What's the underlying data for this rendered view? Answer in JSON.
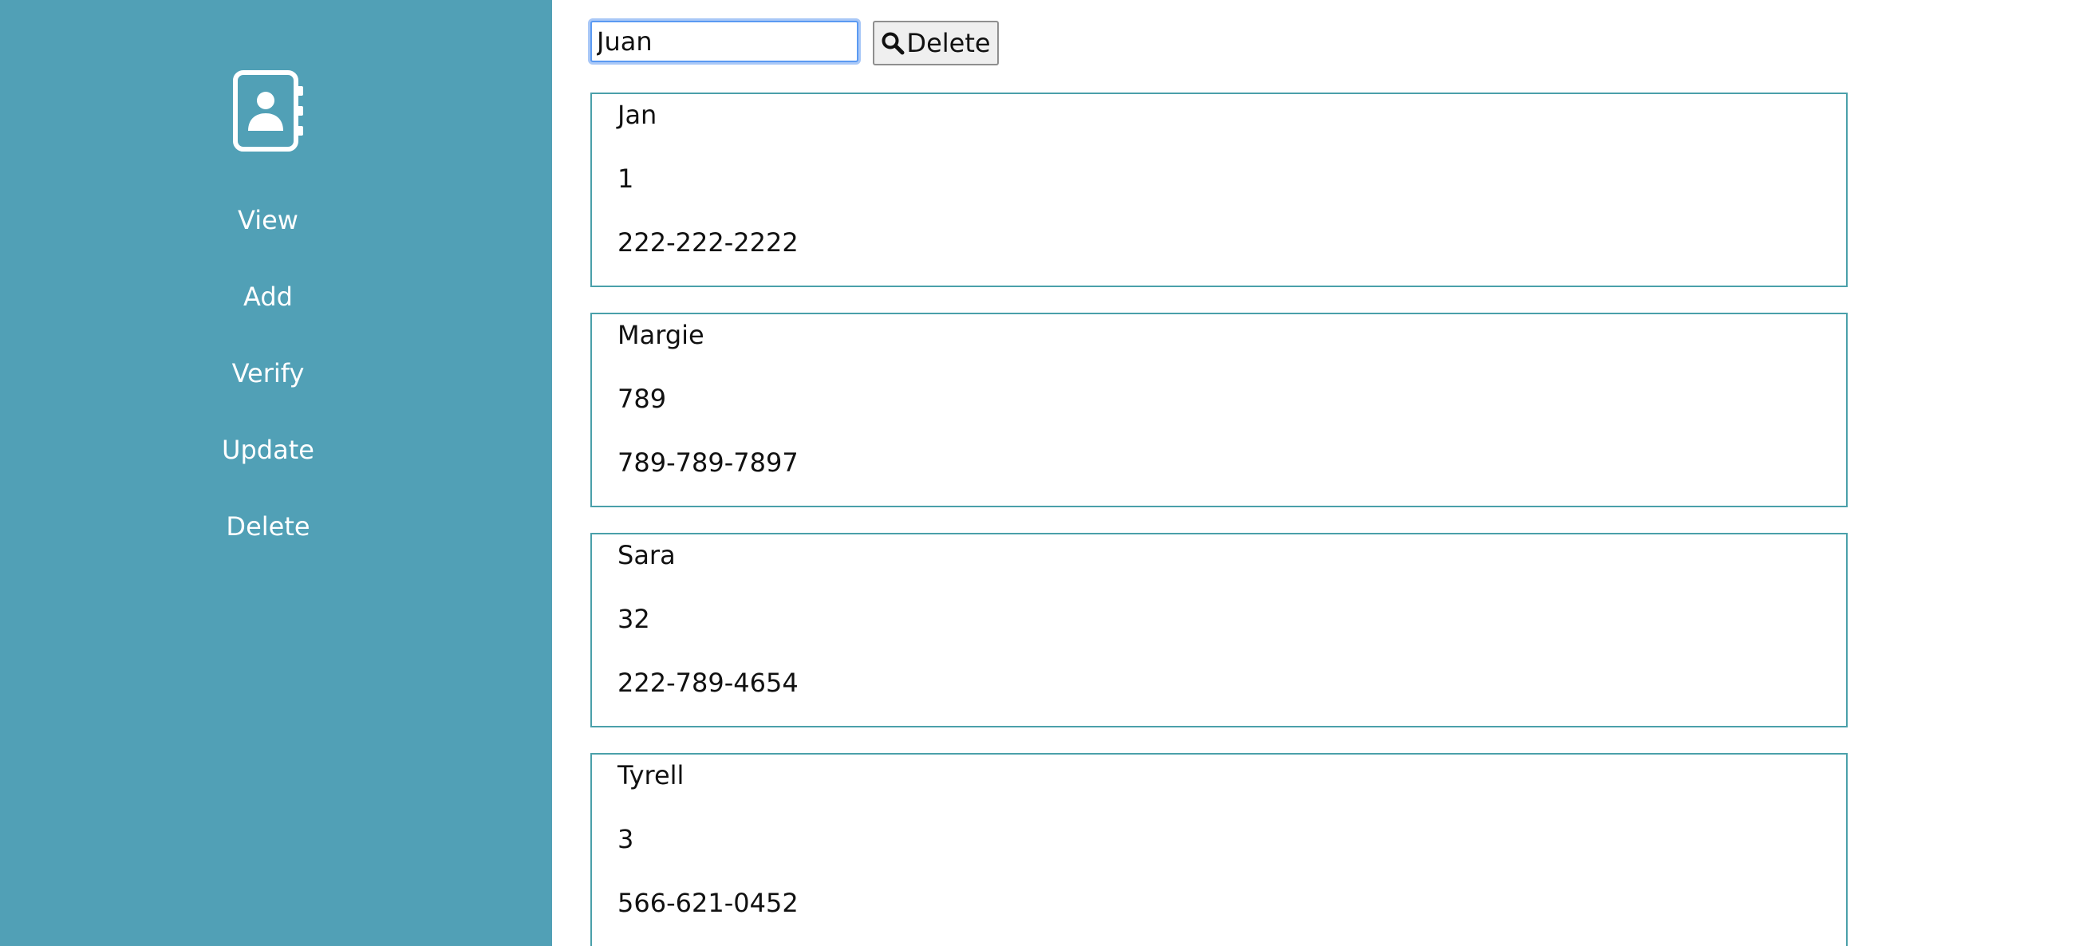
{
  "sidebar": {
    "logo_icon": "contact-book-icon",
    "nav_items": [
      {
        "label": "View"
      },
      {
        "label": "Add"
      },
      {
        "label": "Verify"
      },
      {
        "label": "Update"
      },
      {
        "label": "Delete"
      }
    ]
  },
  "search": {
    "value": "Juan",
    "button_icon": "search-icon",
    "button_label": "Delete"
  },
  "contacts": [
    {
      "name": "Jan",
      "id": "1",
      "phone": "222-222-2222"
    },
    {
      "name": "Margie",
      "id": "789",
      "phone": "789-789-7897"
    },
    {
      "name": "Sara",
      "id": "32",
      "phone": "222-789-4654"
    },
    {
      "name": "Tyrell",
      "id": "3",
      "phone": "566-621-0452"
    }
  ],
  "colors": {
    "sidebar_bg": "#51a0b6",
    "card_border": "#4aa0aa",
    "input_focus": "#5b9af2"
  }
}
